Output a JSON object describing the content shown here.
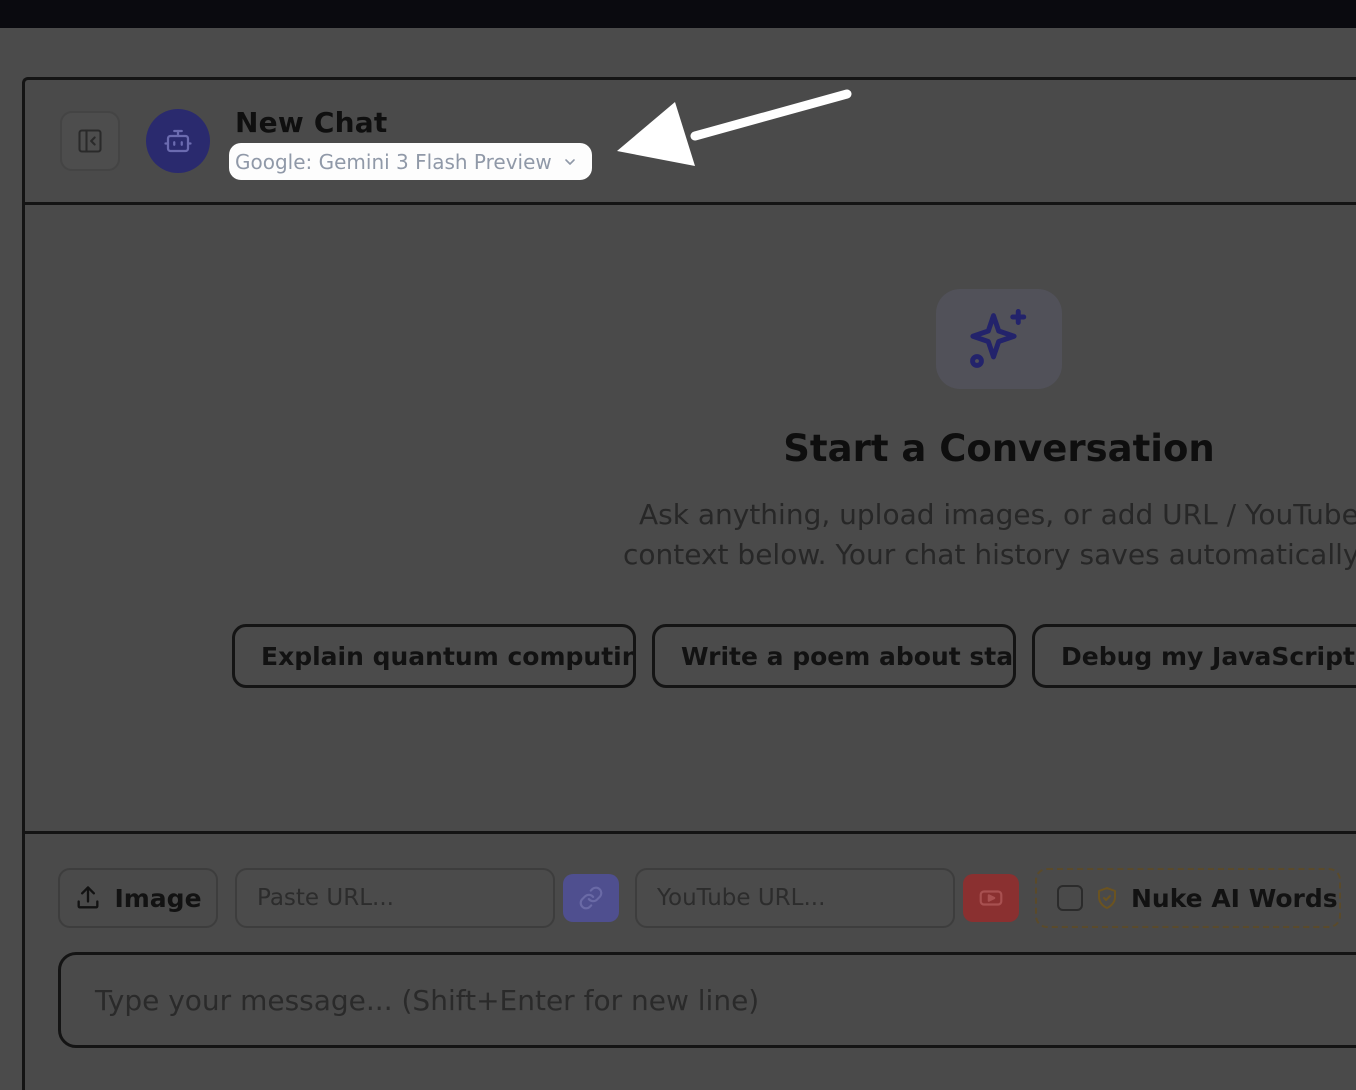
{
  "header": {
    "title": "New Chat",
    "model_label": "Google: Gemini 3 Flash Preview"
  },
  "empty_state": {
    "title": "Start a Conversation",
    "subtitle_line1": "Ask anything, upload images, or add URL / YouTube",
    "subtitle_line2": "context below. Your chat history saves automatically"
  },
  "suggestions": [
    "Explain quantum computing",
    "Write a poem about stars",
    "Debug my JavaScript co"
  ],
  "composer": {
    "image_label": "Image",
    "url_placeholder": "Paste URL...",
    "youtube_placeholder": "YouTube URL...",
    "nuke_label": "Nuke AI Words",
    "nuke_checked": false,
    "message_placeholder": "Type your message... (Shift+Enter for new line)"
  },
  "colors": {
    "avatar_bg": "#2a2a6e",
    "link_button": "#4f4f8f",
    "youtube_button": "#8a3030",
    "annotation_arrow": "#ffffff"
  },
  "icons": [
    "sidebar-collapse-icon",
    "robot-icon",
    "chevron-down-icon",
    "sparkles-icon",
    "upload-icon",
    "link-icon",
    "youtube-icon",
    "shield-icon"
  ]
}
